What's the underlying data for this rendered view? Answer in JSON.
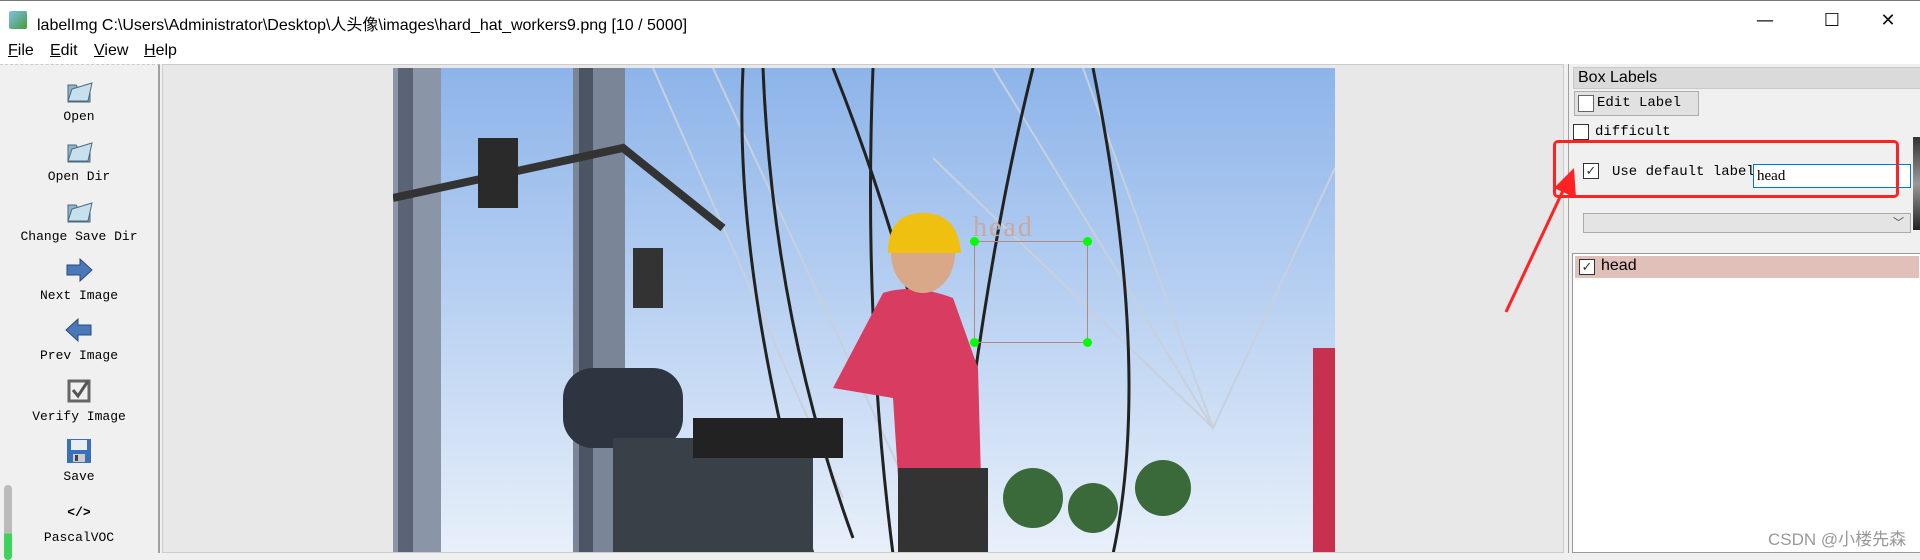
{
  "window": {
    "title": "labelImg C:\\Users\\Administrator\\Desktop\\人头像\\images\\hard_hat_workers9.png [10 / 5000]",
    "minimize": "—",
    "maximize": "☐",
    "close": "✕"
  },
  "menu": [
    {
      "key": "F",
      "rest": "ile"
    },
    {
      "key": "E",
      "rest": "dit"
    },
    {
      "key": "V",
      "rest": "iew"
    },
    {
      "key": "H",
      "rest": "elp"
    }
  ],
  "toolbar": [
    {
      "label": "Open",
      "icon": "folder-icon"
    },
    {
      "label": "Open Dir",
      "icon": "folder-icon"
    },
    {
      "label": "Change Save Dir",
      "icon": "folder-icon"
    },
    {
      "label": "Next Image",
      "icon": "arrow-right-icon"
    },
    {
      "label": "Prev Image",
      "icon": "arrow-left-icon"
    },
    {
      "label": "Verify Image",
      "icon": "checkbox-icon"
    },
    {
      "label": "Save",
      "icon": "floppy-icon"
    },
    {
      "label": "PascalVOC",
      "icon": "code-icon",
      "glyph": "</>"
    }
  ],
  "canvas": {
    "box_label": "head",
    "box_color": "#00ff00"
  },
  "dock": {
    "title": "Box Labels",
    "edit_label": "Edit Label",
    "difficult": "difficult",
    "difficult_checked": false,
    "use_default": "Use default label",
    "use_default_checked": true,
    "default_label_value": "head",
    "combo_value": "",
    "labels": [
      {
        "text": "head",
        "checked": true,
        "color": "#e0c0b8"
      }
    ]
  },
  "check_glyph": "✓",
  "annotation_color": "#ff2222",
  "watermark": "CSDN @小楼先森"
}
